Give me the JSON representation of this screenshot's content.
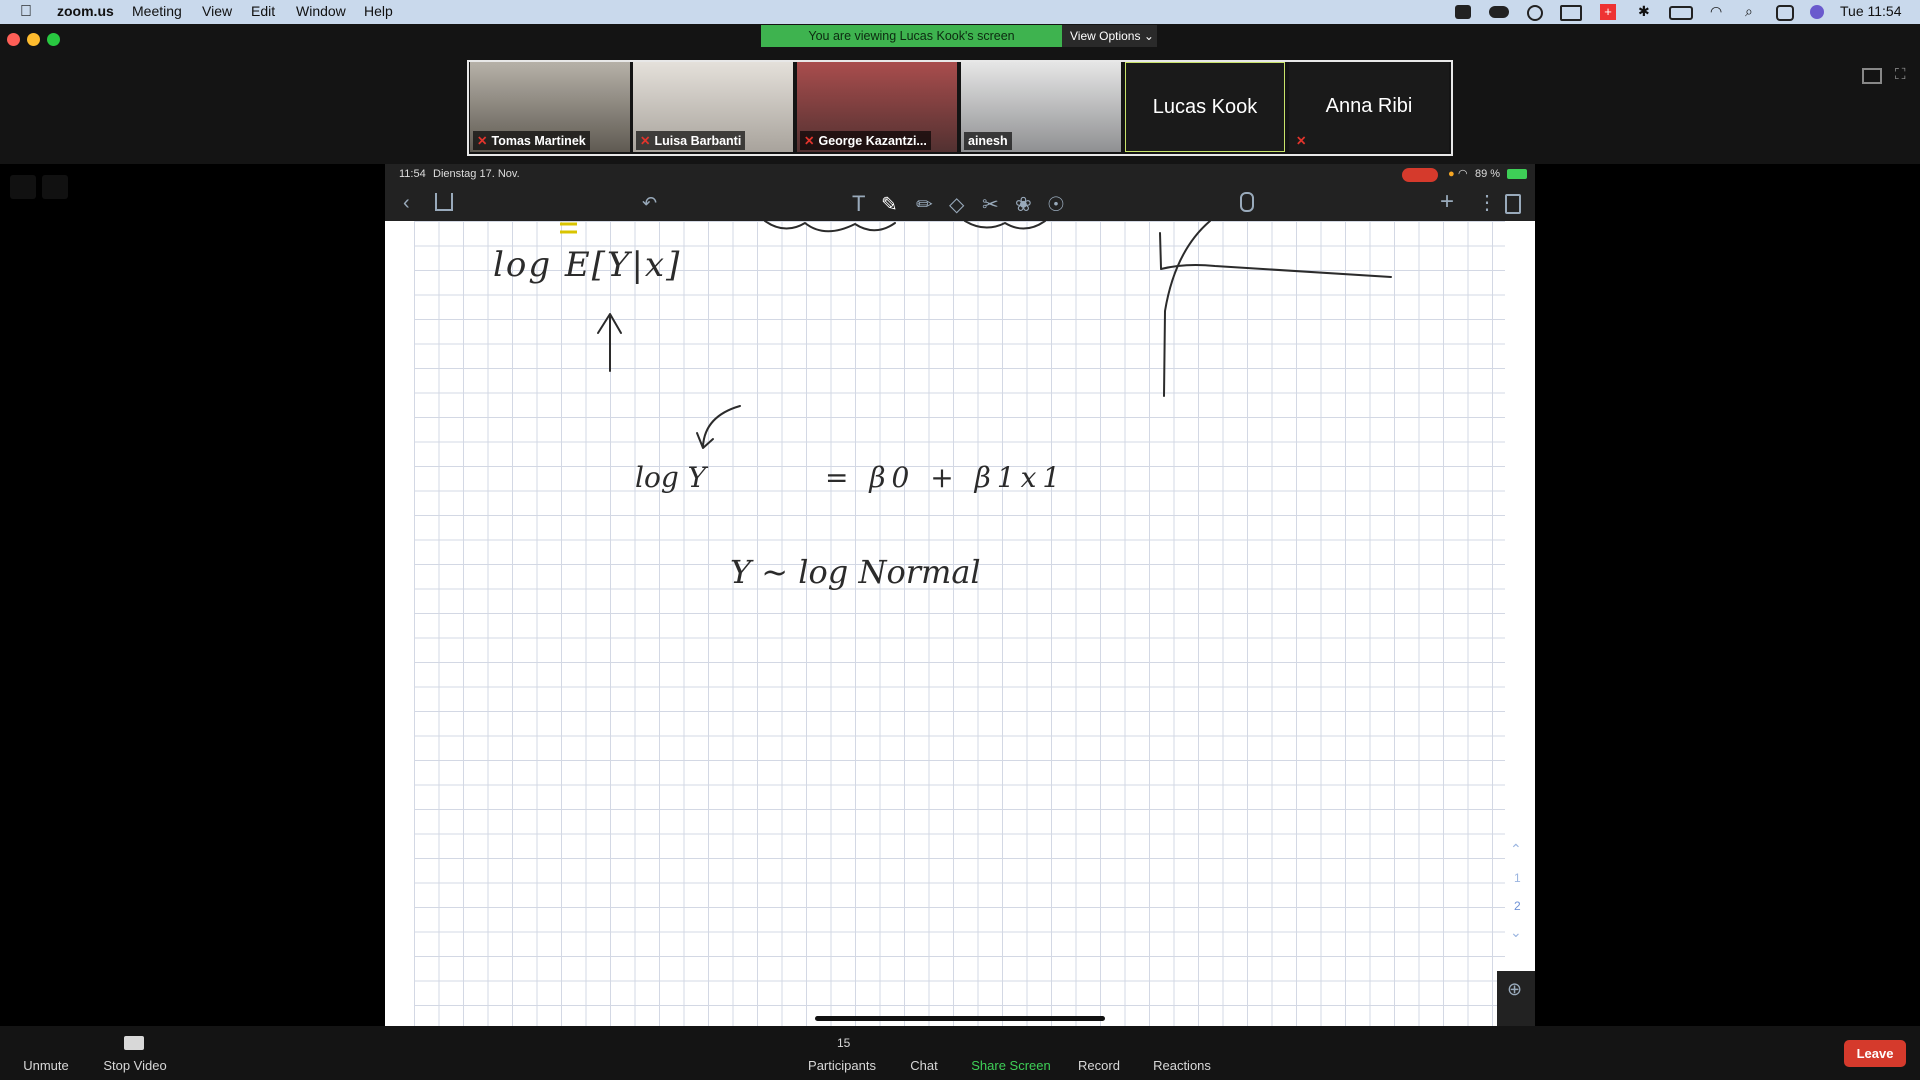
{
  "menubar": {
    "app": "zoom.us",
    "items": [
      "Meeting",
      "View",
      "Edit",
      "Window",
      "Help"
    ],
    "clock": "Tue 11:54"
  },
  "banner": {
    "text": "You are viewing Lucas Kook's screen",
    "view_options": "View Options"
  },
  "gallery": [
    {
      "name": "Tomas Martinek",
      "muted": true,
      "video": true
    },
    {
      "name": "Luisa Barbanti",
      "muted": true,
      "video": true
    },
    {
      "name": "George Kazantzi...",
      "muted": true,
      "video": true
    },
    {
      "name": "ainesh",
      "muted": false,
      "video": true
    },
    {
      "name": "Lucas Kook",
      "muted": false,
      "video": false
    },
    {
      "name": "Anna Ribi",
      "muted": true,
      "video": false
    }
  ],
  "ipad": {
    "time": "11:54",
    "date": "Dienstag 17. Nov.",
    "battery": "89 %",
    "page_indicator": [
      "1",
      "2"
    ]
  },
  "notes": {
    "line1": "log E[Y|x]",
    "line2": "log Y",
    "line2b": "= β0 + β1x1",
    "line3": "Y ~ log Normal"
  },
  "toolbar": {
    "unmute": "Unmute",
    "stop_video": "Stop Video",
    "participants_count": "15",
    "participants": "Participants",
    "chat": "Chat",
    "share_screen": "Share Screen",
    "record": "Record",
    "reactions": "Reactions",
    "leave": "Leave"
  },
  "colors": {
    "menubar_bg": "#c9d9ec",
    "banner_green": "#3eb34f",
    "share_green": "#3ecf57",
    "leave_red": "#d53a2c"
  }
}
